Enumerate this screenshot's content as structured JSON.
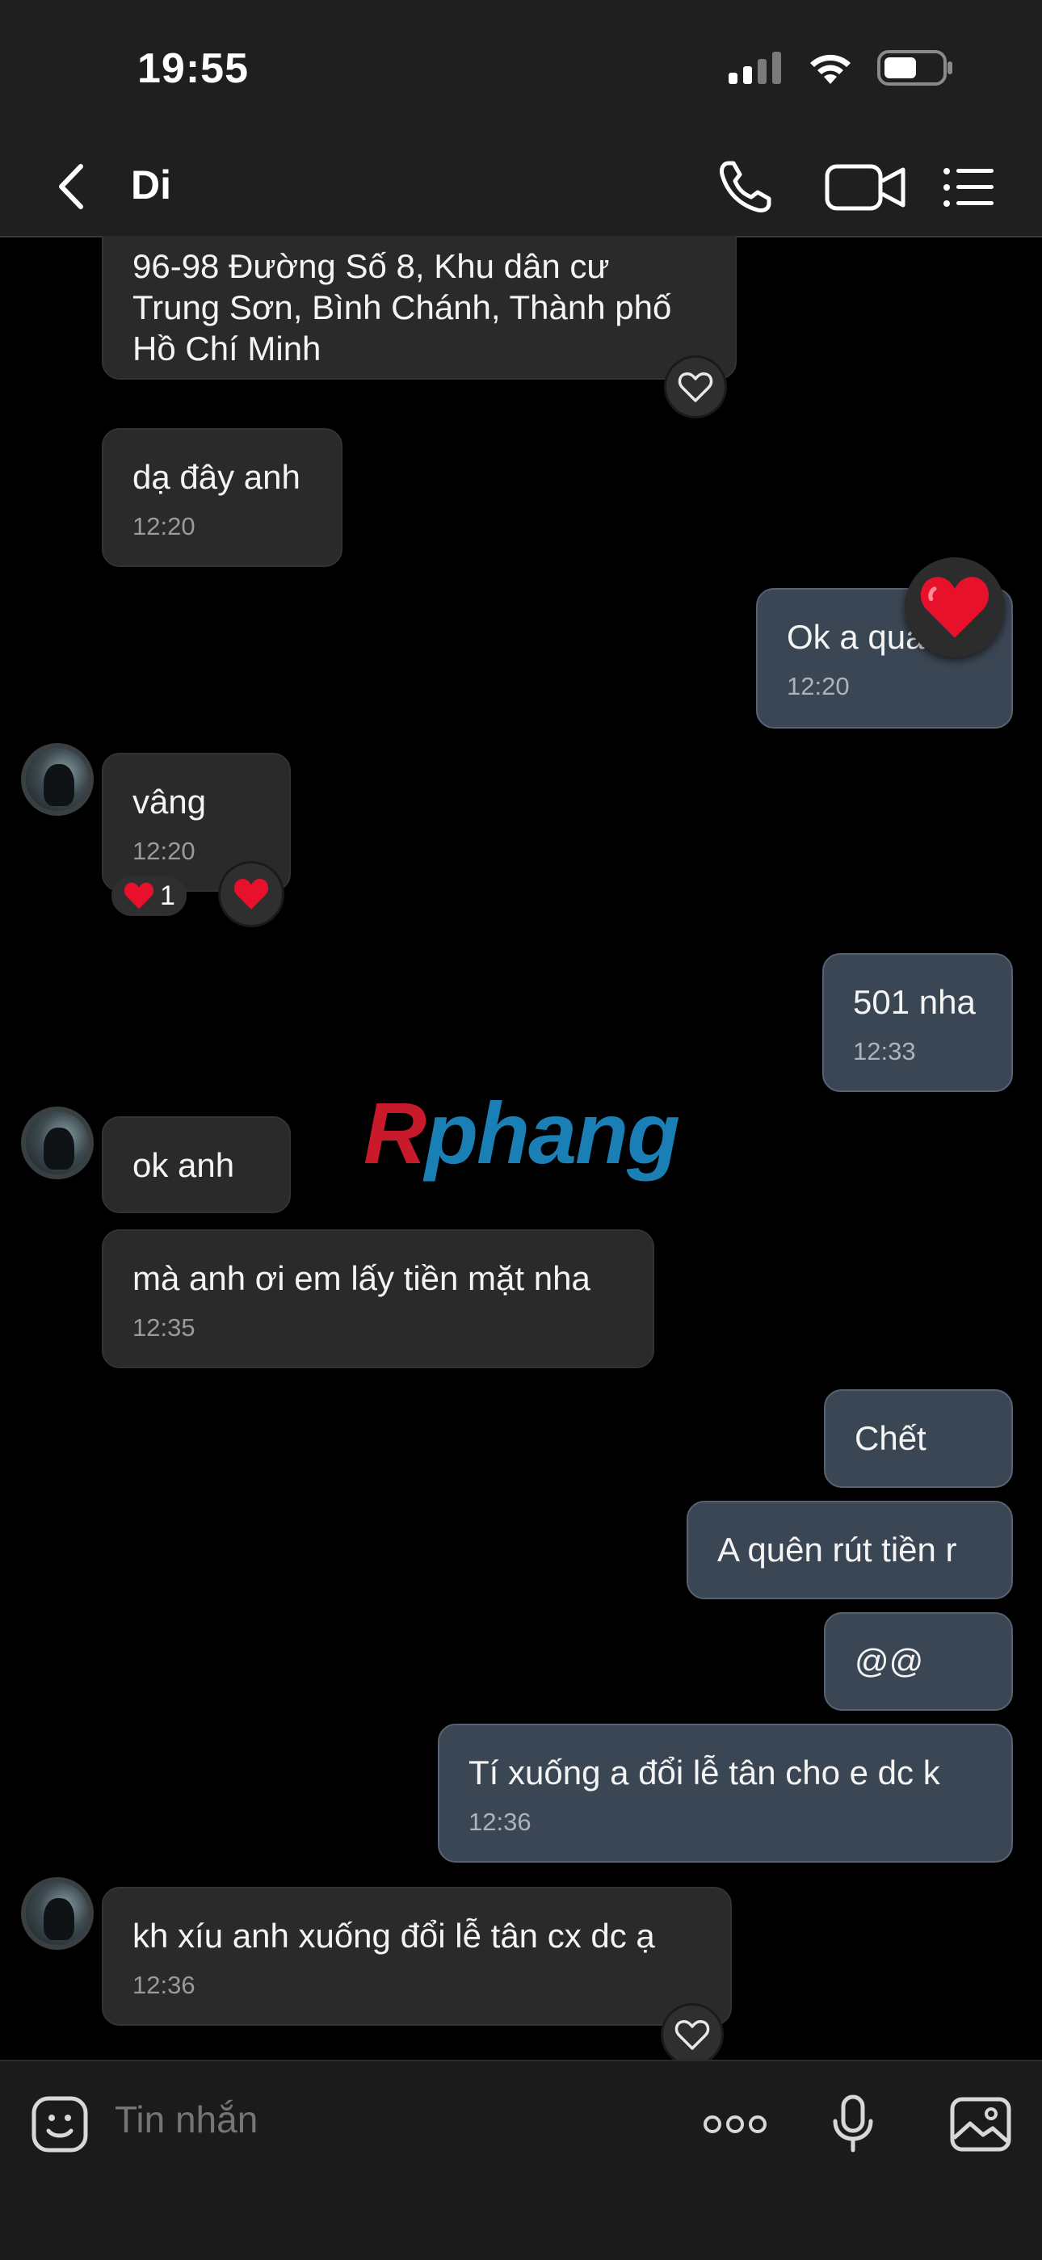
{
  "status_bar": {
    "time": "19:55",
    "battery_level": 0.55
  },
  "header": {
    "title": "Di"
  },
  "messages": [
    {
      "text": "96-98 Đường Số 8, Khu dân cư\nTrung Sơn, Bình Chánh, Thành phố\nHồ Chí Minh",
      "time": ""
    },
    {
      "text": "dạ đây anh",
      "time": "12:20"
    },
    {
      "text": "Ok a quá",
      "time": "12:20"
    },
    {
      "text": "vâng",
      "time": "12:20",
      "reaction_count": "1"
    },
    {
      "text": "501 nha",
      "time": "12:33"
    },
    {
      "text": "ok anh",
      "time": ""
    },
    {
      "text": "mà anh ơi em lấy tiền mặt nha",
      "time": "12:35"
    },
    {
      "text": "Chết",
      "time": ""
    },
    {
      "text": "A quên rút tiền r",
      "time": ""
    },
    {
      "text": "@@",
      "time": ""
    },
    {
      "text": "Tí xuống a đổi lễ tân cho e dc k",
      "time": "12:36"
    },
    {
      "text": "kh xíu anh xuống đổi lễ tân cx dc ạ",
      "time": "12:36"
    }
  ],
  "watermark": {
    "part1": "R",
    "part2": "phang"
  },
  "composer": {
    "placeholder": "Tin nhắn"
  },
  "colors": {
    "incoming_bubble": "#2a2a2a",
    "outgoing_bubble": "#3b4654",
    "heart": "#e8102a"
  }
}
